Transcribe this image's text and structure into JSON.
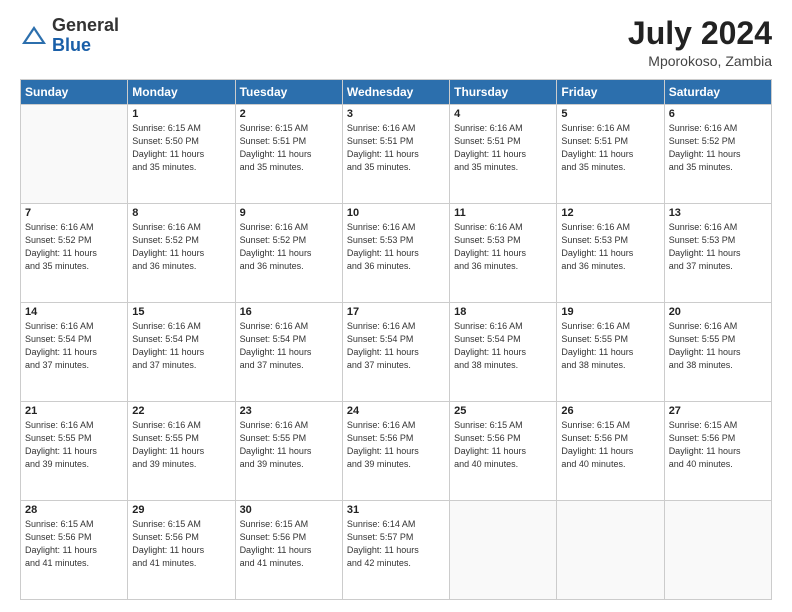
{
  "header": {
    "logo": {
      "general": "General",
      "blue": "Blue"
    },
    "title": "July 2024",
    "location": "Mporokoso, Zambia"
  },
  "weekdays": [
    "Sunday",
    "Monday",
    "Tuesday",
    "Wednesday",
    "Thursday",
    "Friday",
    "Saturday"
  ],
  "weeks": [
    [
      {
        "day": "",
        "info": ""
      },
      {
        "day": "1",
        "info": "Sunrise: 6:15 AM\nSunset: 5:50 PM\nDaylight: 11 hours\nand 35 minutes."
      },
      {
        "day": "2",
        "info": "Sunrise: 6:15 AM\nSunset: 5:51 PM\nDaylight: 11 hours\nand 35 minutes."
      },
      {
        "day": "3",
        "info": "Sunrise: 6:16 AM\nSunset: 5:51 PM\nDaylight: 11 hours\nand 35 minutes."
      },
      {
        "day": "4",
        "info": "Sunrise: 6:16 AM\nSunset: 5:51 PM\nDaylight: 11 hours\nand 35 minutes."
      },
      {
        "day": "5",
        "info": "Sunrise: 6:16 AM\nSunset: 5:51 PM\nDaylight: 11 hours\nand 35 minutes."
      },
      {
        "day": "6",
        "info": "Sunrise: 6:16 AM\nSunset: 5:52 PM\nDaylight: 11 hours\nand 35 minutes."
      }
    ],
    [
      {
        "day": "7",
        "info": "Sunrise: 6:16 AM\nSunset: 5:52 PM\nDaylight: 11 hours\nand 35 minutes."
      },
      {
        "day": "8",
        "info": "Sunrise: 6:16 AM\nSunset: 5:52 PM\nDaylight: 11 hours\nand 36 minutes."
      },
      {
        "day": "9",
        "info": "Sunrise: 6:16 AM\nSunset: 5:52 PM\nDaylight: 11 hours\nand 36 minutes."
      },
      {
        "day": "10",
        "info": "Sunrise: 6:16 AM\nSunset: 5:53 PM\nDaylight: 11 hours\nand 36 minutes."
      },
      {
        "day": "11",
        "info": "Sunrise: 6:16 AM\nSunset: 5:53 PM\nDaylight: 11 hours\nand 36 minutes."
      },
      {
        "day": "12",
        "info": "Sunrise: 6:16 AM\nSunset: 5:53 PM\nDaylight: 11 hours\nand 36 minutes."
      },
      {
        "day": "13",
        "info": "Sunrise: 6:16 AM\nSunset: 5:53 PM\nDaylight: 11 hours\nand 37 minutes."
      }
    ],
    [
      {
        "day": "14",
        "info": "Sunrise: 6:16 AM\nSunset: 5:54 PM\nDaylight: 11 hours\nand 37 minutes."
      },
      {
        "day": "15",
        "info": "Sunrise: 6:16 AM\nSunset: 5:54 PM\nDaylight: 11 hours\nand 37 minutes."
      },
      {
        "day": "16",
        "info": "Sunrise: 6:16 AM\nSunset: 5:54 PM\nDaylight: 11 hours\nand 37 minutes."
      },
      {
        "day": "17",
        "info": "Sunrise: 6:16 AM\nSunset: 5:54 PM\nDaylight: 11 hours\nand 37 minutes."
      },
      {
        "day": "18",
        "info": "Sunrise: 6:16 AM\nSunset: 5:54 PM\nDaylight: 11 hours\nand 38 minutes."
      },
      {
        "day": "19",
        "info": "Sunrise: 6:16 AM\nSunset: 5:55 PM\nDaylight: 11 hours\nand 38 minutes."
      },
      {
        "day": "20",
        "info": "Sunrise: 6:16 AM\nSunset: 5:55 PM\nDaylight: 11 hours\nand 38 minutes."
      }
    ],
    [
      {
        "day": "21",
        "info": "Sunrise: 6:16 AM\nSunset: 5:55 PM\nDaylight: 11 hours\nand 39 minutes."
      },
      {
        "day": "22",
        "info": "Sunrise: 6:16 AM\nSunset: 5:55 PM\nDaylight: 11 hours\nand 39 minutes."
      },
      {
        "day": "23",
        "info": "Sunrise: 6:16 AM\nSunset: 5:55 PM\nDaylight: 11 hours\nand 39 minutes."
      },
      {
        "day": "24",
        "info": "Sunrise: 6:16 AM\nSunset: 5:56 PM\nDaylight: 11 hours\nand 39 minutes."
      },
      {
        "day": "25",
        "info": "Sunrise: 6:15 AM\nSunset: 5:56 PM\nDaylight: 11 hours\nand 40 minutes."
      },
      {
        "day": "26",
        "info": "Sunrise: 6:15 AM\nSunset: 5:56 PM\nDaylight: 11 hours\nand 40 minutes."
      },
      {
        "day": "27",
        "info": "Sunrise: 6:15 AM\nSunset: 5:56 PM\nDaylight: 11 hours\nand 40 minutes."
      }
    ],
    [
      {
        "day": "28",
        "info": "Sunrise: 6:15 AM\nSunset: 5:56 PM\nDaylight: 11 hours\nand 41 minutes."
      },
      {
        "day": "29",
        "info": "Sunrise: 6:15 AM\nSunset: 5:56 PM\nDaylight: 11 hours\nand 41 minutes."
      },
      {
        "day": "30",
        "info": "Sunrise: 6:15 AM\nSunset: 5:56 PM\nDaylight: 11 hours\nand 41 minutes."
      },
      {
        "day": "31",
        "info": "Sunrise: 6:14 AM\nSunset: 5:57 PM\nDaylight: 11 hours\nand 42 minutes."
      },
      {
        "day": "",
        "info": ""
      },
      {
        "day": "",
        "info": ""
      },
      {
        "day": "",
        "info": ""
      }
    ]
  ]
}
